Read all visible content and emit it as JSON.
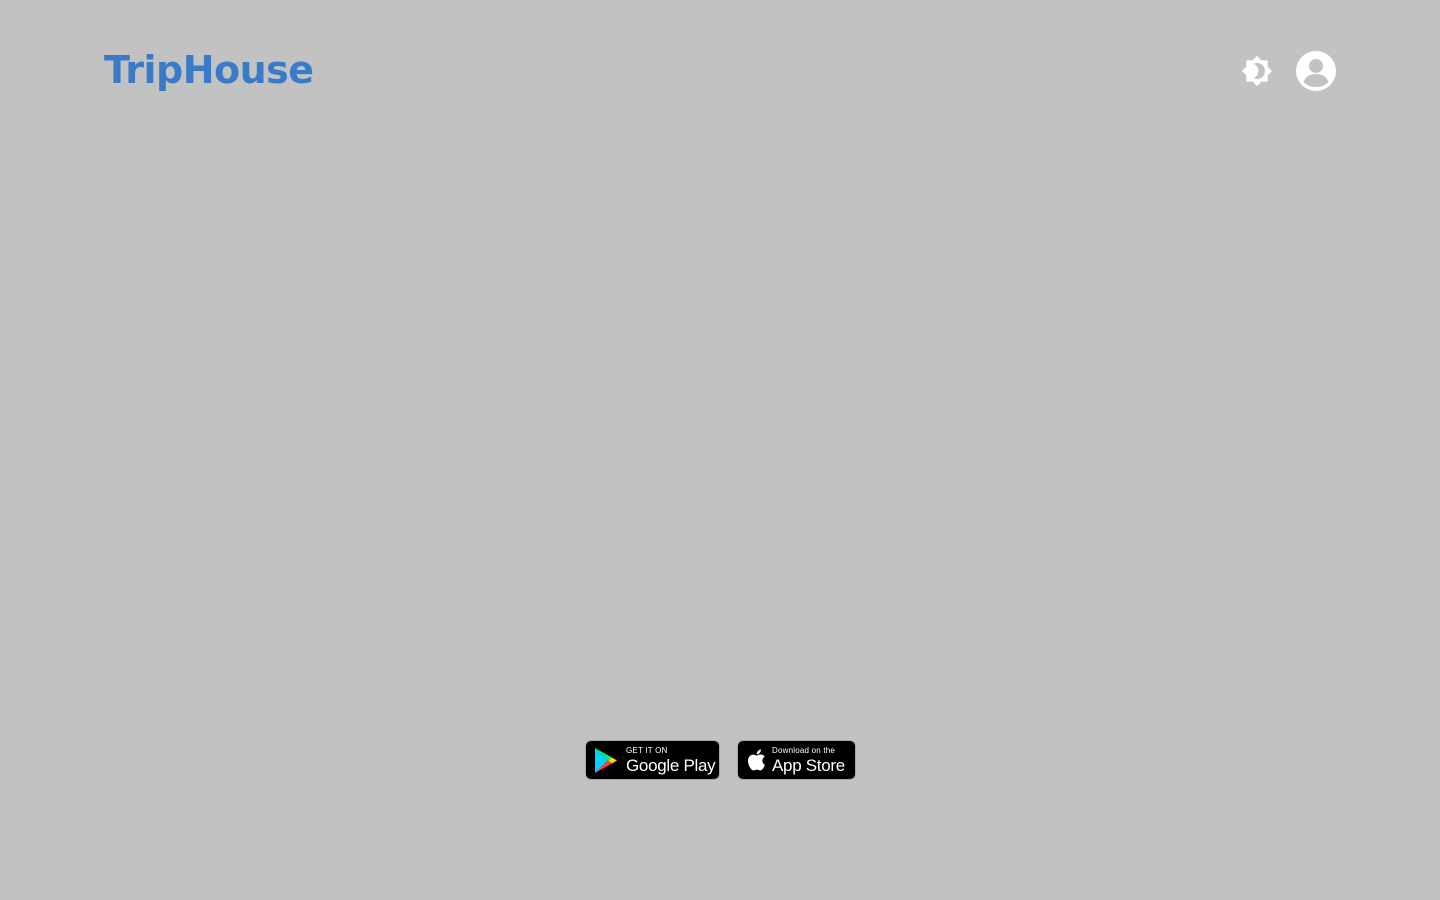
{
  "header": {
    "brand": "TripHouse",
    "theme_toggle_icon": "brightness-icon",
    "account_icon": "account-circle-icon"
  },
  "store_badges": {
    "google_play": {
      "top_line": "GET IT ON",
      "main_line": "Google Play",
      "icon": "google-play-icon"
    },
    "app_store": {
      "top_line": "Download on the",
      "main_line": "App Store",
      "icon": "apple-icon"
    }
  },
  "colors": {
    "background": "#c2c2c2",
    "brand": "#3a7bc8",
    "icon": "#ffffff",
    "badge_bg": "#000000"
  }
}
